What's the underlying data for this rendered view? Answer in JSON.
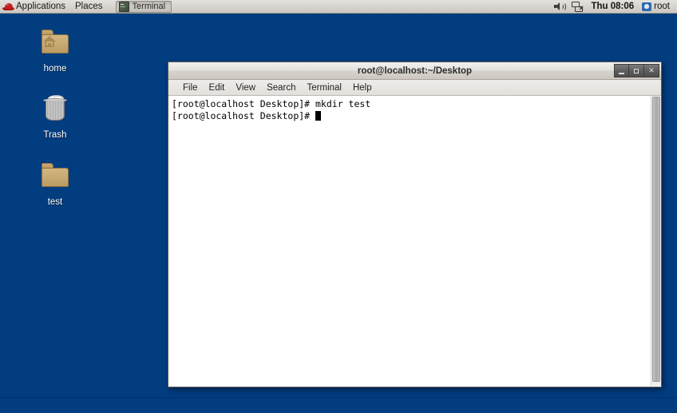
{
  "top_panel": {
    "logo_icon": "redhat-logo-icon",
    "menus": [
      {
        "label": "Applications"
      },
      {
        "label": "Places"
      }
    ],
    "task_button": {
      "icon": "terminal-icon",
      "label": "Terminal"
    },
    "tray": {
      "volume_icon": "speaker-volume-icon",
      "network_icon": "network-disconnected-icon",
      "clock": "Thu 08:06",
      "user_icon": "user-account-icon",
      "user": "root"
    }
  },
  "desktop": {
    "background_color": "#023d80",
    "icons": [
      {
        "label": "home",
        "icon": "home-folder-icon"
      },
      {
        "label": "Trash",
        "icon": "trash-can-icon"
      },
      {
        "label": "test",
        "icon": "folder-icon"
      }
    ]
  },
  "terminal": {
    "title": "root@localhost:~/Desktop",
    "window_buttons": {
      "minimize": "minimize-icon",
      "maximize": "maximize-icon",
      "close": "✕"
    },
    "menu": [
      {
        "label": "File"
      },
      {
        "label": "Edit"
      },
      {
        "label": "View"
      },
      {
        "label": "Search"
      },
      {
        "label": "Terminal"
      },
      {
        "label": "Help"
      }
    ],
    "lines": [
      "[root@localhost Desktop]# mkdir test",
      "[root@localhost Desktop]# "
    ],
    "content": "[root@localhost Desktop]# mkdir test\n[root@localhost Desktop]# ",
    "foreground_color": "#000000",
    "background_color": "#ffffff"
  }
}
